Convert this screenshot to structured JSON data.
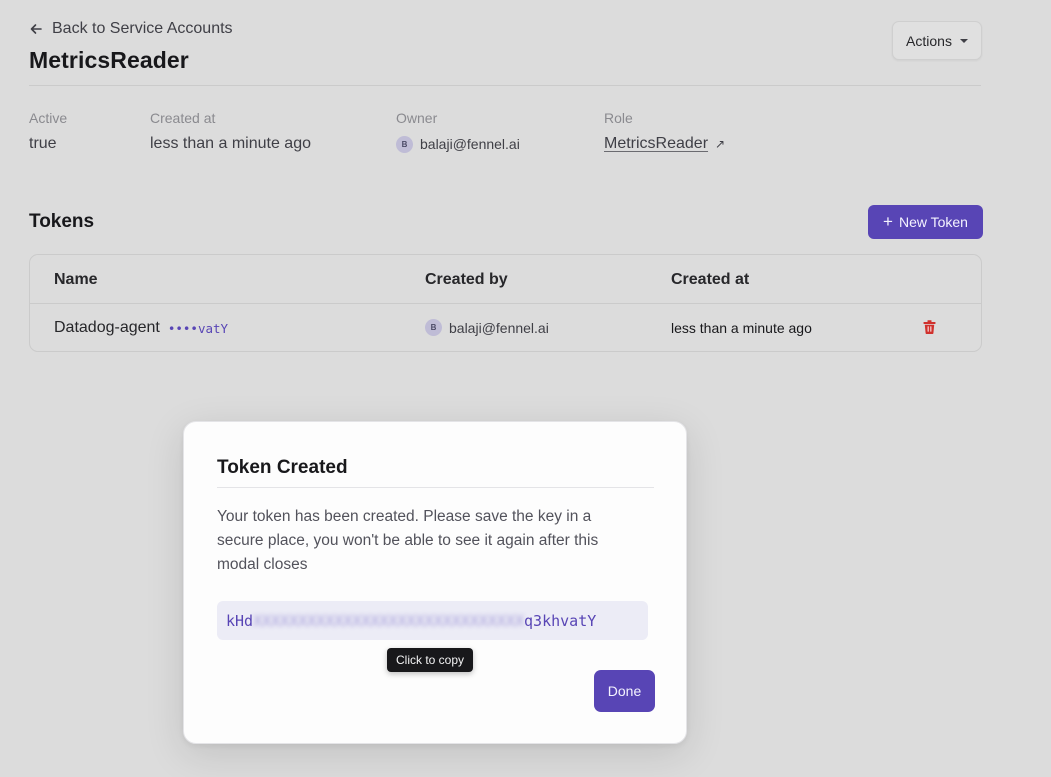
{
  "header": {
    "back_label": "Back to Service Accounts",
    "title": "MetricsReader",
    "actions_label": "Actions"
  },
  "details": {
    "active": {
      "label": "Active",
      "value": "true"
    },
    "created_at": {
      "label": "Created at",
      "value": "less than a minute ago"
    },
    "owner": {
      "label": "Owner",
      "avatar_initial": "B",
      "value": "balaji@fennel.ai"
    },
    "role": {
      "label": "Role",
      "value": "MetricsReader",
      "icon": "external-link-icon"
    }
  },
  "tokens": {
    "title": "Tokens",
    "new_token_label": "New Token",
    "columns": [
      "Name",
      "Created by",
      "Created at"
    ],
    "rows": [
      {
        "name": "Datadog-agent",
        "masked": "••••vatY",
        "created_by_initial": "B",
        "created_by": "balaji@fennel.ai",
        "created_at": "less than a minute ago"
      }
    ]
  },
  "modal": {
    "title": "Token Created",
    "body": "Your token has been created. Please save the key in a secure place, you won't be able to see it again after this modal closes",
    "token_prefix": "kHd",
    "token_suffix": "q3khvatY",
    "tooltip": "Click to copy",
    "done_label": "Done"
  },
  "colors": {
    "accent": "#5845b5",
    "danger": "#d0312d",
    "background": "#dcdcdc"
  }
}
